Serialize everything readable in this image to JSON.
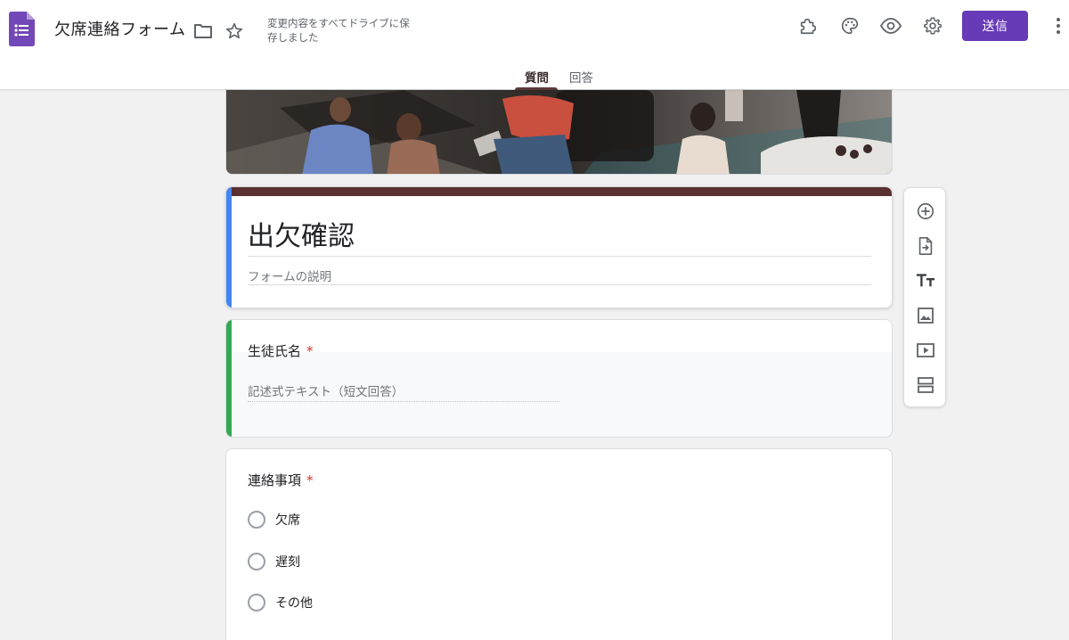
{
  "header": {
    "doc_title": "欠席連絡フォーム",
    "save_status": "変更内容をすべてドライブに保存しました",
    "send_label": "送信",
    "icons": [
      "forms-app-icon",
      "folder-icon",
      "star-icon",
      "addon-puzzle-icon",
      "palette-icon",
      "preview-eye-icon",
      "settings-gear-icon",
      "more-vert-icon"
    ],
    "accent_color": "#673ab7"
  },
  "tabs": [
    {
      "label": "質問",
      "active": true
    },
    {
      "label": "回答",
      "active": false
    }
  ],
  "form": {
    "title": "出欠確認",
    "description_placeholder": "フォームの説明",
    "theme_color": "#5b3030",
    "title_accent": "#4285f4"
  },
  "questions": [
    {
      "title": "生徒氏名",
      "required_mark": "*",
      "answer_placeholder": "記述式テキスト（短文回答）",
      "accent": "#34a853"
    },
    {
      "title": "連絡事項",
      "required_mark": "*",
      "options": [
        "欠席",
        "遅刻",
        "その他"
      ]
    }
  ],
  "toolbar": {
    "icons": [
      "add-question-icon",
      "import-questions-icon",
      "add-title-icon",
      "add-image-icon",
      "add-video-icon",
      "add-section-icon"
    ]
  }
}
